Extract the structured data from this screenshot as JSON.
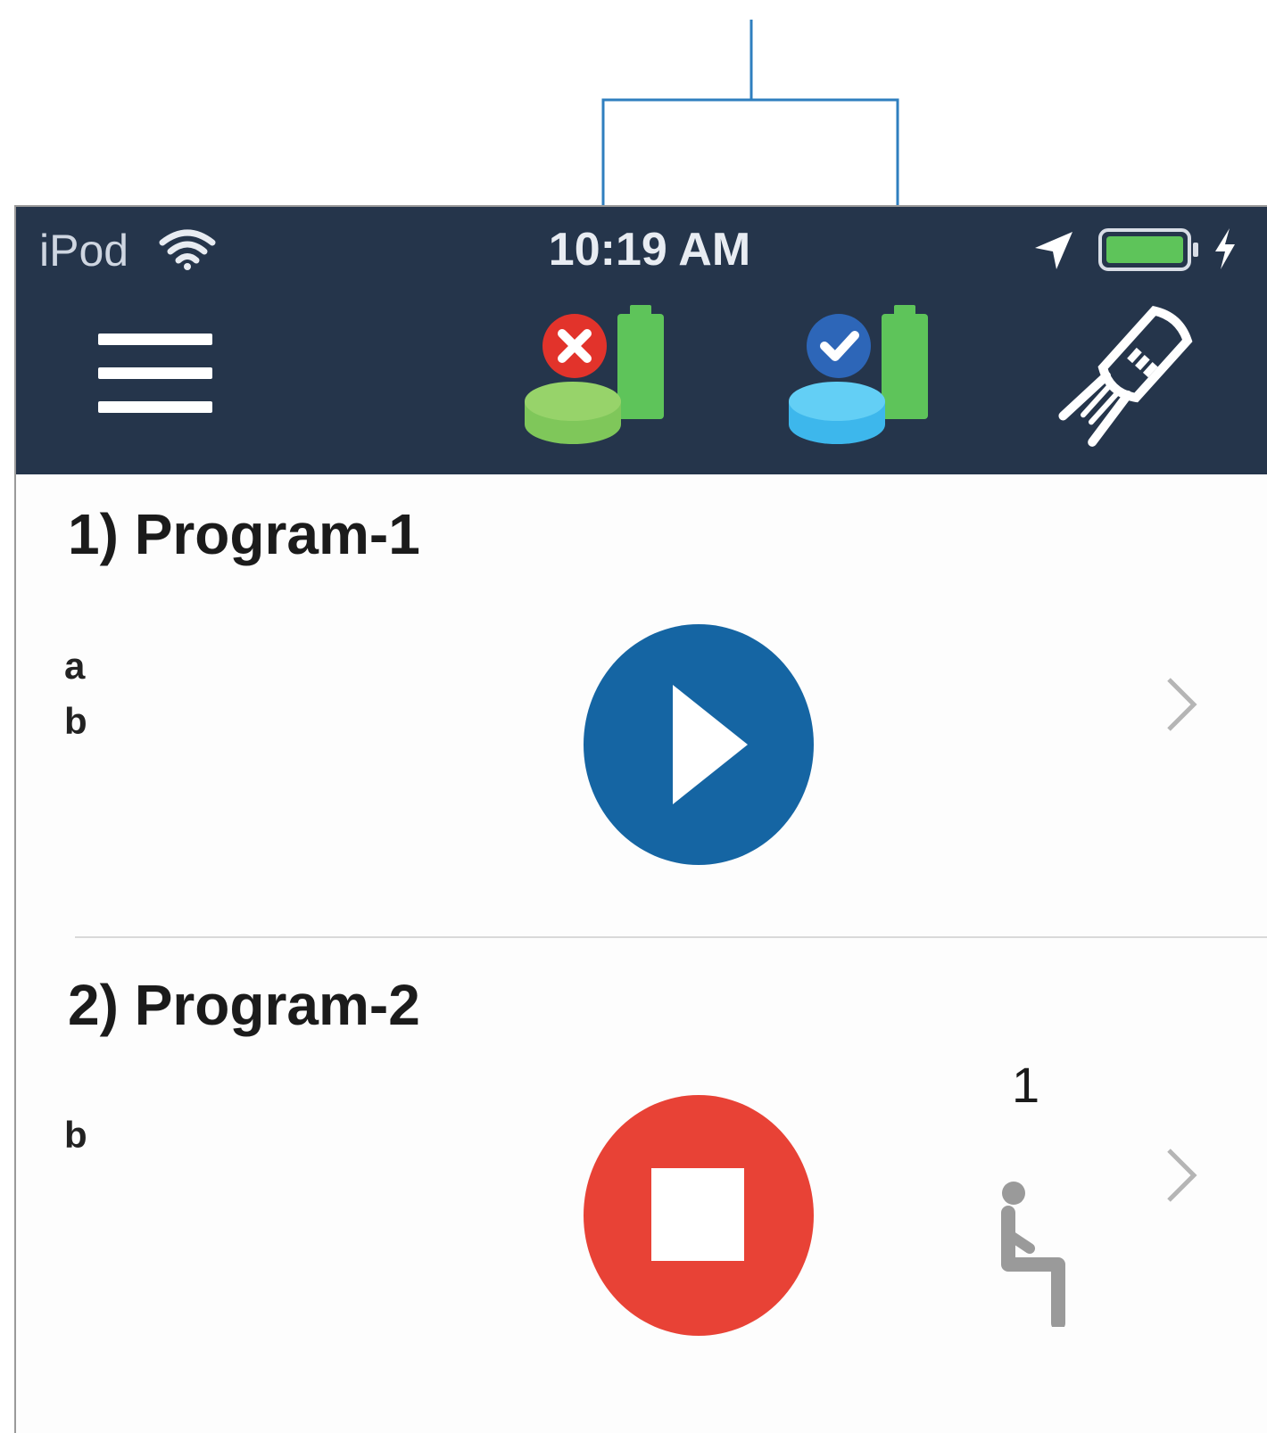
{
  "status_bar": {
    "carrier": "iPod",
    "time": "10:19 AM",
    "battery_color": "#5ec45a"
  },
  "toolbar": {
    "menu_icon": "hamburger-menu-icon",
    "sensor_disconnected_icon": "sensor-disconnected-battery-icon",
    "sensor_connected_icon": "sensor-connected-battery-icon",
    "probe_icon": "probe-clip-icon"
  },
  "programs": [
    {
      "title": "1) Program-1",
      "lines": [
        "a",
        "b"
      ],
      "action": "play",
      "action_color": "#1565a3"
    },
    {
      "title": "2) Program-2",
      "lines": [
        "b"
      ],
      "action": "stop",
      "action_color": "#e84236",
      "count": "1",
      "status_icon": "seated-person-icon"
    }
  ],
  "colors": {
    "topbar": "#25354b",
    "callout_line": "#2f7fbf"
  }
}
